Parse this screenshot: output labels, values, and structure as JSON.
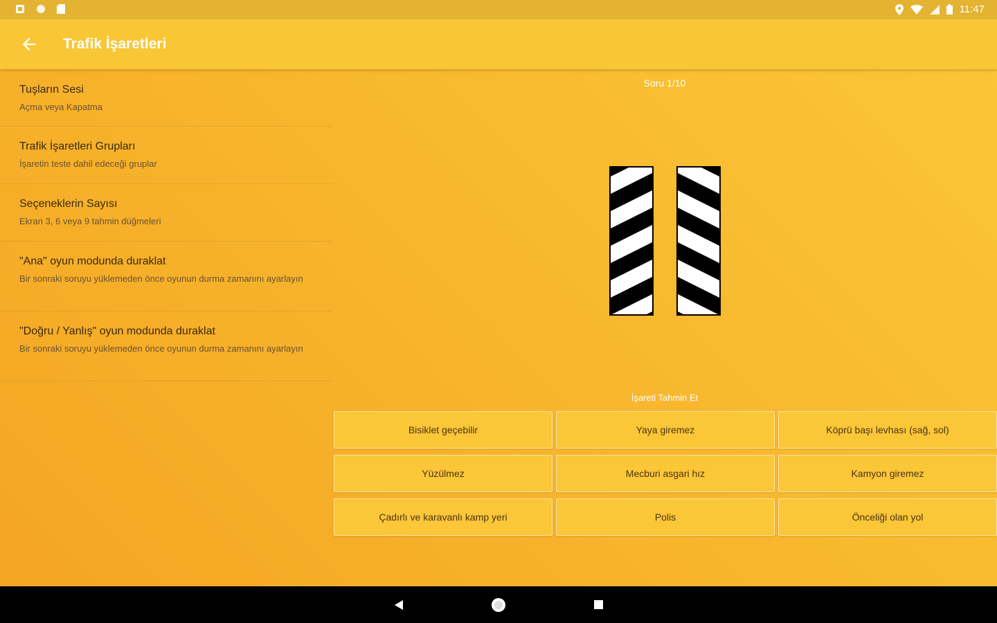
{
  "status_bar": {
    "time": "11:47",
    "left_icons": [
      "notification-icon",
      "circle-icon",
      "sd-card-icon"
    ],
    "right_icons": [
      "location-icon",
      "wifi-icon",
      "signal-icon",
      "battery-icon"
    ]
  },
  "app_bar": {
    "title": "Trafik İşaretleri",
    "back_icon": "arrow-left-icon"
  },
  "settings": [
    {
      "title": "Tuşların Sesi",
      "subtitle": "Açma veya Kapatma"
    },
    {
      "title": "Trafik İşaretleri Grupları",
      "subtitle": "İşaretin teste dahil edeceği gruplar"
    },
    {
      "title": "Seçeneklerin Sayısı",
      "subtitle": "Ekran 3, 6 veya 9 tahmin düğmeleri"
    },
    {
      "title": "\"Ana\" oyun modunda duraklat",
      "subtitle": "Bir sonraki soruyu yüklemeden önce oyunun durma zamanını ayarlayın"
    },
    {
      "title": "\"Doğru / Yanlış\" oyun modunda duraklat",
      "subtitle": "Bir sonraki soruyu yüklemeden önce oyunun durma zamanını ayarlayın"
    }
  ],
  "quiz": {
    "question_counter": "Soru 1/10",
    "guess_label": "İşareti Tahmin Et",
    "sign_icon": "bridge-pillar-chevron-sign",
    "answers": [
      "Bisiklet geçebilir",
      "Yaya giremez",
      "Köprü başı levhası (sağ, sol)",
      "Yüzülmez",
      "Mecburi asgari hız",
      "Kamyon giremez",
      "Çadırlı ve karavanlı kamp yeri",
      "Polis",
      "Önceliği olan yol"
    ]
  },
  "colors": {
    "status_bar": "#e4b332",
    "app_bar": "#f9c635",
    "background_start": "#f4a523",
    "background_end": "#fbc537",
    "button": "#fbc637"
  },
  "nav_bar": {
    "icons": [
      "back-triangle-icon",
      "home-circle-icon",
      "recents-square-icon"
    ]
  }
}
